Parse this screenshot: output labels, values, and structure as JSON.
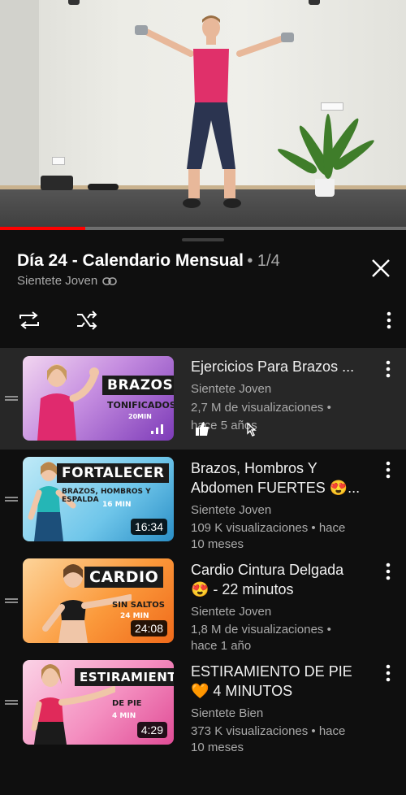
{
  "video": {
    "progress_fraction": 0.21
  },
  "playlist": {
    "title": "Día 24 - Calendario Mensual",
    "count": "• 1/4",
    "channel": "Sientete Joven"
  },
  "items": [
    {
      "title": "Ejercicios Para Brazos ...",
      "channel": "Sientete Joven",
      "meta1": "2,7 M de visualizaciones •",
      "meta2": "hace 5 años",
      "duration": "",
      "thumb_label": "BRAZOS",
      "thumb_sub": "TONIFICADOS",
      "thumb_sub2": "20MIN",
      "active": true
    },
    {
      "title_line1": "Brazos, Hombros Y",
      "title_line2": "Abdomen FUERTES 😍...",
      "channel": "Sientete Joven",
      "meta1": "109 K visualizaciones • hace",
      "meta2": "10 meses",
      "duration": "16:34",
      "thumb_label": "FORTALECER",
      "thumb_sub": "BRAZOS, HOMBROS Y ESPALDA",
      "thumb_sub2": "16 MIN"
    },
    {
      "title_line1": "Cardio Cintura Delgada",
      "title_line2": "😍 - 22 minutos",
      "channel": "Sientete Joven",
      "meta1": "1,8 M de visualizaciones •",
      "meta2": "hace 1 año",
      "duration": "24:08",
      "thumb_label": "CARDIO",
      "thumb_sub": "SIN SALTOS",
      "thumb_sub2": "24 MIN"
    },
    {
      "title_line1": "ESTIRAMIENTO DE PIE",
      "title_line2": "🧡 4 MINUTOS",
      "channel": "Sientete Bien",
      "meta1": "373 K visualizaciones • hace",
      "meta2": "10 meses",
      "duration": "4:29",
      "thumb_label": "ESTIRAMIENTO",
      "thumb_sub": "DE PIE",
      "thumb_sub2": "4 MIN"
    }
  ],
  "colors": {
    "accent": "#ff0000",
    "background": "#0f0f0f",
    "active_row": "#272727",
    "secondary_text": "#aaaaaa"
  },
  "icons": [
    "link-icon",
    "close-icon",
    "loop-icon",
    "shuffle-icon",
    "more-vert-icon",
    "drag-handle-icon"
  ]
}
